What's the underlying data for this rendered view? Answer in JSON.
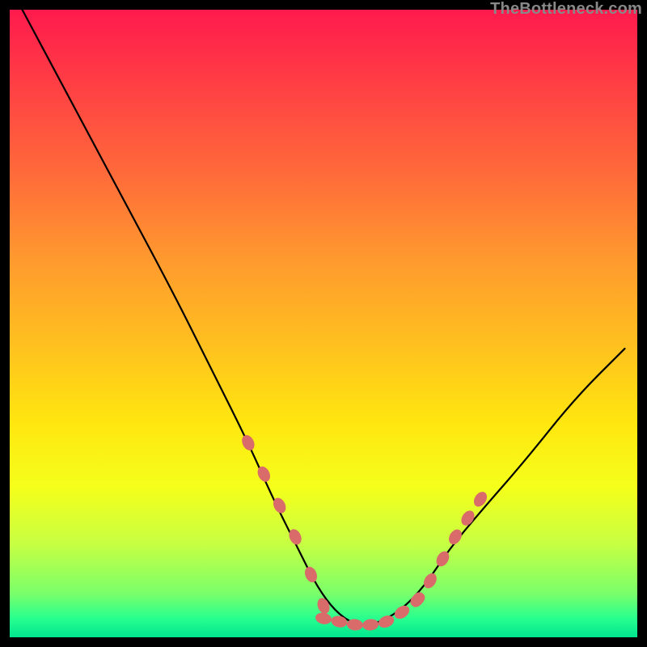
{
  "watermark": {
    "text": "TheBottleneck.com"
  },
  "chart_data": {
    "type": "line",
    "title": "",
    "xlabel": "",
    "ylabel": "",
    "xlim": [
      0,
      100
    ],
    "ylim": [
      0,
      100
    ],
    "grid": false,
    "legend": false,
    "series": [
      {
        "name": "curve",
        "color": "#000000",
        "x": [
          2,
          10,
          18,
          26,
          32,
          38,
          42,
          46,
          49,
          52,
          55,
          58,
          62,
          66,
          70,
          75,
          82,
          90,
          98
        ],
        "values": [
          100,
          85,
          70,
          55,
          43,
          31,
          22,
          14,
          8,
          4,
          2,
          2,
          4,
          8,
          14,
          20,
          28,
          38,
          46
        ]
      }
    ],
    "dotted_segments": [
      {
        "name": "left-threshold",
        "color": "#d96b6b",
        "x": [
          38,
          40.5,
          43,
          45.5,
          48,
          50
        ],
        "values": [
          31,
          26,
          21,
          16,
          10,
          5
        ]
      },
      {
        "name": "bottom-flat",
        "color": "#d96b6b",
        "x": [
          50,
          52.5,
          55,
          57.5,
          60,
          62.5,
          65
        ],
        "values": [
          3,
          2.5,
          2,
          2,
          2.5,
          4,
          6
        ]
      },
      {
        "name": "right-threshold",
        "color": "#d96b6b",
        "x": [
          65,
          67,
          69,
          71,
          73,
          75
        ],
        "values": [
          6,
          9,
          12.5,
          16,
          19,
          22
        ]
      }
    ]
  }
}
